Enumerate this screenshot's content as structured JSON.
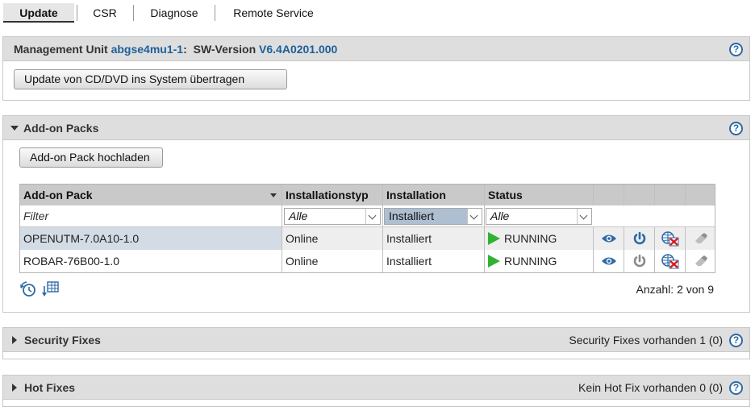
{
  "tabs": [
    {
      "label": "Update",
      "active": true
    },
    {
      "label": "CSR",
      "active": false
    },
    {
      "label": "Diagnose",
      "active": false
    },
    {
      "label": "Remote Service",
      "active": false
    }
  ],
  "mgmt": {
    "prefix": "Management Unit",
    "unit": "abgse4mu1-1",
    "colon": ":",
    "sw_label": "SW-Version",
    "version": "V6.4A0201.000",
    "button": "Update von CD/DVD ins System übertragen"
  },
  "addon": {
    "title": "Add-on Packs",
    "upload_button": "Add-on Pack hochladen",
    "columns": [
      "Add-on Pack",
      "Installationstyp",
      "Installation",
      "Status"
    ],
    "filter": {
      "name": "Filter",
      "type": "Alle",
      "installation": "Installiert",
      "status": "Alle"
    },
    "rows": [
      {
        "name": "OPENUTM-7.0A10-1.0",
        "type": "Online",
        "installation": "Installiert",
        "status": "RUNNING"
      },
      {
        "name": "ROBAR-76B00-1.0",
        "type": "Online",
        "installation": "Installiert",
        "status": "RUNNING"
      }
    ],
    "count": "Anzahl: 2 von 9"
  },
  "security": {
    "title": "Security Fixes",
    "status": "Security Fixes vorhanden 1 (0)"
  },
  "hotfix": {
    "title": "Hot Fixes",
    "status": "Kein Hot Fix vorhanden 0 (0)"
  },
  "help_glyph": "?",
  "colors": {
    "link": "#1c5f9a",
    "running": "#31b231",
    "header_bg": "#dedede",
    "selected_row": "#d3dbe5"
  }
}
